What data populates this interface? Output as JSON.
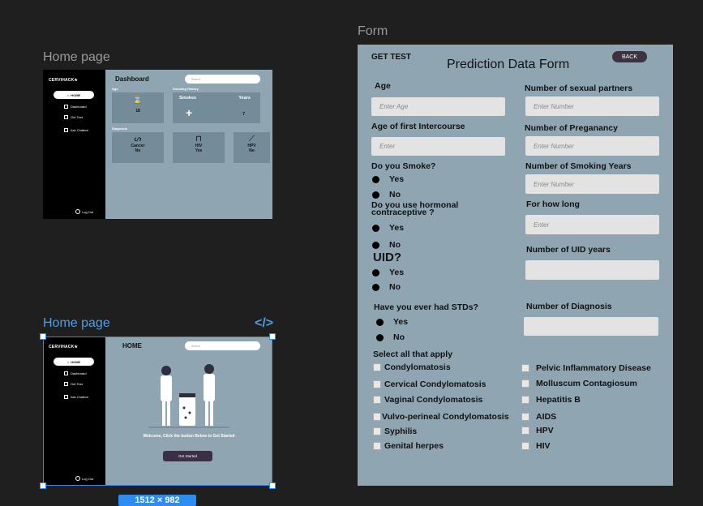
{
  "frames": {
    "home1_label": "Home page",
    "home2_label": "Home page",
    "form_label": "Form",
    "code_icon": "</>",
    "size_badge": "1512 × 982"
  },
  "dashboard": {
    "logo": "CERVIHACK★",
    "nav_home": "HOME",
    "nav_items": [
      "Dashboard",
      "Get Test",
      "Ask Chatbot"
    ],
    "logout": "Log Out",
    "search_placeholder": "Search",
    "title": "Dashboard",
    "age_label": "Age",
    "age_value": "18",
    "smoking_label": "Smoking History",
    "smokes_label": "Smokes",
    "years_label": "Years",
    "years_value": "7",
    "diagnosis_label": "Diagnosis",
    "cancer_label": "Cancer",
    "cancer_value": "No",
    "hiv_label": "HIV",
    "hiv_value": "Yes",
    "hpv_label": "HPV",
    "hpv_value": "No"
  },
  "home": {
    "title": "HOME",
    "welcome": "Welcome, Click the button Below to Get Started",
    "get_started": "Get Started"
  },
  "form": {
    "get_test": "GET TEST",
    "title": "Prediction Data  Form",
    "back": "BACK",
    "age_label": "Age",
    "age_placeholder": "Enter Age",
    "first_intercourse_label": "Age of first Intercourse",
    "first_intercourse_placeholder": "Enter",
    "smoke_q": "Do you Smoke?",
    "hormonal_q": "Do you use hormonal contraceptive ?",
    "uid_q": "UID?",
    "stds_q": "Have you ever had STDs?",
    "yes": "Yes",
    "no": "No",
    "partners_label": "Number of sexual partners",
    "partners_placeholder": "Enter Number",
    "pregnancy_label": "Number of Preganancy",
    "pregnancy_placeholder": "Enter Number",
    "smoking_years_label": "Number of Smoking Years",
    "smoking_years_placeholder": "Enter Number",
    "how_long_label": "For how long",
    "how_long_placeholder": "Enter",
    "uid_years_label": "Number of UID years",
    "diagnosis_label": "Number of Diagnosis",
    "select_all": "Select all that apply",
    "conditions_left": [
      "Condylomatosis",
      "Cervical Condylomatosis",
      "Vaginal Condylomatosis",
      "Vulvo-perineal Condylomatosis",
      "Syphilis",
      "Genital herpes"
    ],
    "conditions_right": [
      "Pelvic  Inflammatory Disease",
      "Molluscum Contagiosum",
      "Hepatitis B",
      "AIDS",
      "HPV",
      "HIV"
    ]
  },
  "colors": {
    "canvas": "#1f1f1f",
    "frame": "#8fa5b2",
    "card": "#748b99",
    "selection": "#2d8cf0"
  }
}
